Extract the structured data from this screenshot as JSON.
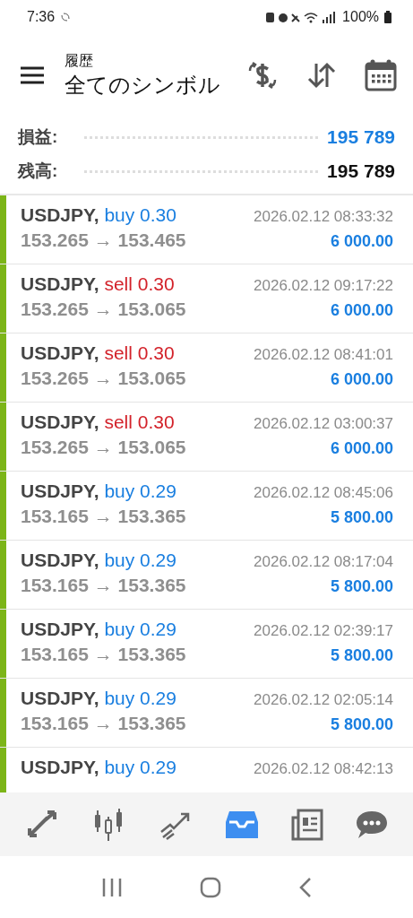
{
  "status_bar": {
    "time": "7:36",
    "battery": "100%"
  },
  "header": {
    "subtitle": "履歴",
    "title": "全てのシンボル"
  },
  "summary": [
    {
      "label": "損益:",
      "value": "195 789",
      "kind": "profit"
    },
    {
      "label": "残高:",
      "value": "195 789",
      "kind": "balance"
    }
  ],
  "deals": [
    {
      "symbol": "USDJPY,",
      "side": "buy",
      "volume": "0.30",
      "color": "#1a7fe0",
      "prices": "153.265 → 153.465",
      "time": "2026.02.12 08:33:32",
      "profit": "6 000.00"
    },
    {
      "symbol": "USDJPY,",
      "side": "sell",
      "volume": "0.30",
      "color": "#d3222a",
      "prices": "153.265 → 153.065",
      "time": "2026.02.12 09:17:22",
      "profit": "6 000.00"
    },
    {
      "symbol": "USDJPY,",
      "side": "sell",
      "volume": "0.30",
      "color": "#d3222a",
      "prices": "153.265 → 153.065",
      "time": "2026.02.12 08:41:01",
      "profit": "6 000.00"
    },
    {
      "symbol": "USDJPY,",
      "side": "sell",
      "volume": "0.30",
      "color": "#d3222a",
      "prices": "153.265 → 153.065",
      "time": "2026.02.12 03:00:37",
      "profit": "6 000.00"
    },
    {
      "symbol": "USDJPY,",
      "side": "buy",
      "volume": "0.29",
      "color": "#1a7fe0",
      "prices": "153.165 → 153.365",
      "time": "2026.02.12 08:45:06",
      "profit": "5 800.00"
    },
    {
      "symbol": "USDJPY,",
      "side": "buy",
      "volume": "0.29",
      "color": "#1a7fe0",
      "prices": "153.165 → 153.365",
      "time": "2026.02.12 08:17:04",
      "profit": "5 800.00"
    },
    {
      "symbol": "USDJPY,",
      "side": "buy",
      "volume": "0.29",
      "color": "#1a7fe0",
      "prices": "153.165 → 153.365",
      "time": "2026.02.12 02:39:17",
      "profit": "5 800.00"
    },
    {
      "symbol": "USDJPY,",
      "side": "buy",
      "volume": "0.29",
      "color": "#1a7fe0",
      "prices": "153.165 → 153.365",
      "time": "2026.02.12 02:05:14",
      "profit": "5 800.00"
    },
    {
      "symbol": "USDJPY,",
      "side": "buy",
      "volume": "0.29",
      "color": "#1a7fe0",
      "time": "2026.02.12 08:42:13"
    }
  ],
  "bottom_nav": [
    {
      "kind": "quotes",
      "selected": false
    },
    {
      "kind": "chart",
      "selected": false
    },
    {
      "kind": "trade",
      "selected": false
    },
    {
      "kind": "history",
      "selected": true
    },
    {
      "kind": "news",
      "selected": false
    },
    {
      "kind": "chat",
      "selected": false
    }
  ]
}
